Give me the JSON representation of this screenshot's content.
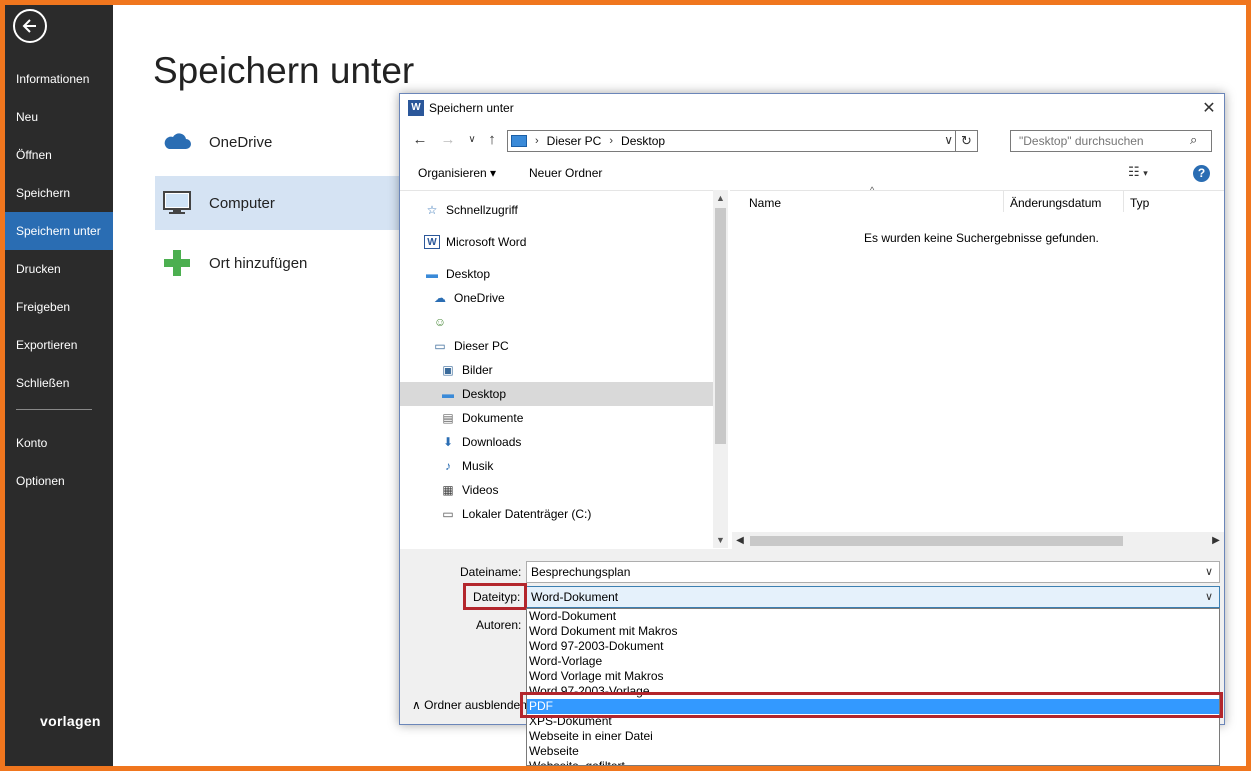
{
  "backstage": {
    "nav": [
      {
        "label": "Informationen",
        "active": false
      },
      {
        "label": "Neu",
        "active": false
      },
      {
        "label": "Öffnen",
        "active": false
      },
      {
        "label": "Speichern",
        "active": false
      },
      {
        "label": "Speichern unter",
        "active": true
      },
      {
        "label": "Drucken",
        "active": false
      },
      {
        "label": "Freigeben",
        "active": false
      },
      {
        "label": "Exportieren",
        "active": false
      },
      {
        "label": "Schließen",
        "active": false
      },
      {
        "label": "Konto",
        "active": false
      },
      {
        "label": "Optionen",
        "active": false
      }
    ],
    "brand": "vorlagen",
    "title": "Speichern unter",
    "places": [
      {
        "label": "OneDrive",
        "icon": "cloud-icon",
        "selected": false
      },
      {
        "label": "Computer",
        "icon": "computer-icon",
        "selected": true
      },
      {
        "label": "Ort hinzufügen",
        "icon": "plus-icon",
        "selected": false
      }
    ]
  },
  "dialog": {
    "title": "Speichern unter",
    "title_icon": "W",
    "address": {
      "crumbs": [
        "Dieser PC",
        "Desktop"
      ]
    },
    "search_placeholder": "\"Desktop\" durchsuchen",
    "toolbar": {
      "organize": "Organisieren ▾",
      "new_folder": "Neuer Ordner"
    },
    "tree": [
      {
        "label": "Schnellzugriff",
        "icon": "star-icon",
        "indent": 0,
        "selected": false
      },
      {
        "label": "Microsoft Word",
        "icon": "word-icon",
        "indent": 0,
        "selected": false
      },
      {
        "label": "Desktop",
        "icon": "desktop-icon",
        "indent": 0,
        "selected": false
      },
      {
        "label": "OneDrive",
        "icon": "cloud-icon",
        "indent": 1,
        "selected": false
      },
      {
        "label": "",
        "icon": "user-icon",
        "indent": 1,
        "selected": false
      },
      {
        "label": "Dieser PC",
        "icon": "computer-icon",
        "indent": 1,
        "selected": false
      },
      {
        "label": "Bilder",
        "icon": "pictures-icon",
        "indent": 2,
        "selected": false
      },
      {
        "label": "Desktop",
        "icon": "desktop-icon",
        "indent": 2,
        "selected": true
      },
      {
        "label": "Dokumente",
        "icon": "document-icon",
        "indent": 2,
        "selected": false
      },
      {
        "label": "Downloads",
        "icon": "download-icon",
        "indent": 2,
        "selected": false
      },
      {
        "label": "Musik",
        "icon": "music-icon",
        "indent": 2,
        "selected": false
      },
      {
        "label": "Videos",
        "icon": "video-icon",
        "indent": 2,
        "selected": false
      },
      {
        "label": "Lokaler Datenträger (C:)",
        "icon": "drive-icon",
        "indent": 2,
        "selected": false
      }
    ],
    "columns": [
      "Name",
      "Änderungsdatum",
      "Typ"
    ],
    "empty_message": "Es wurden keine Suchergebnisse gefunden.",
    "form": {
      "filename_label": "Dateiname:",
      "filename_value": "Besprechungsplan",
      "filetype_label": "Dateityp:",
      "filetype_value": "Word-Dokument",
      "authors_label": "Autoren:",
      "folder_toggle": "Ordner ausblenden"
    },
    "filetype_options": [
      {
        "label": "Word-Dokument",
        "highlighted": false
      },
      {
        "label": "Word Dokument mit Makros",
        "highlighted": false
      },
      {
        "label": "Word 97-2003-Dokument",
        "highlighted": false
      },
      {
        "label": "Word-Vorlage",
        "highlighted": false
      },
      {
        "label": "Word Vorlage mit Makros",
        "highlighted": false
      },
      {
        "label": "Word 97-2003-Vorlage",
        "highlighted": false
      },
      {
        "label": "PDF",
        "highlighted": true
      },
      {
        "label": "XPS-Dokument",
        "highlighted": false
      },
      {
        "label": "Webseite in einer Datei",
        "highlighted": false
      },
      {
        "label": "Webseite",
        "highlighted": false
      },
      {
        "label": "Webseite, gefiltert",
        "highlighted": false
      }
    ]
  },
  "colors": {
    "accent": "#2a6db3",
    "highlight": "#3399ff",
    "callout": "#b3262c",
    "frame": "#f0761e"
  }
}
